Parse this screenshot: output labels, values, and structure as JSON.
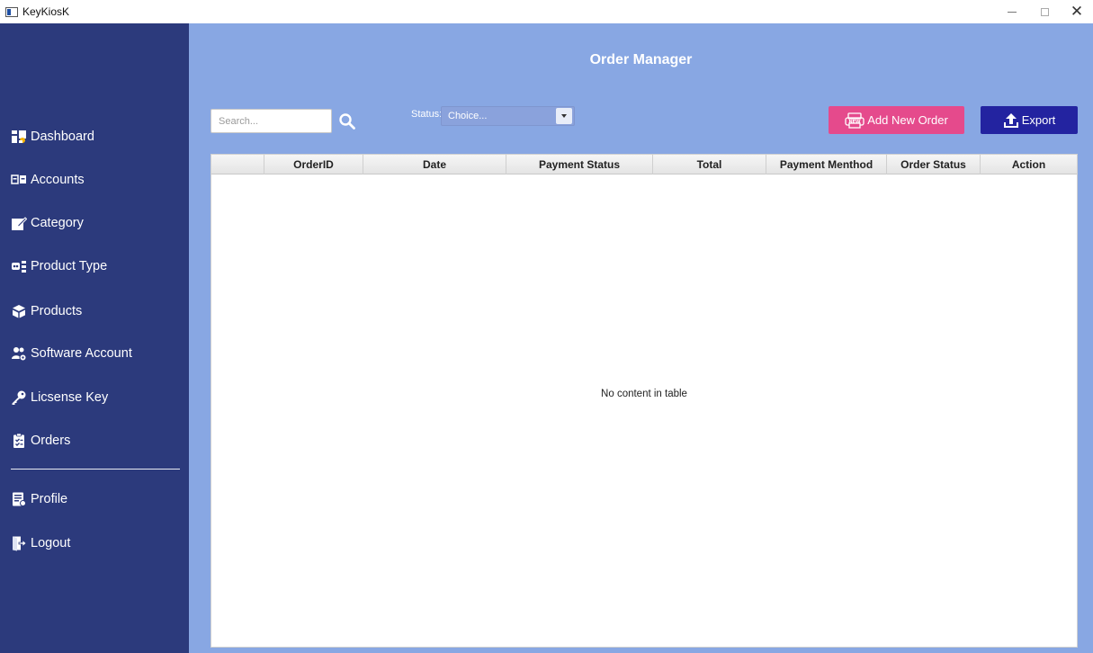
{
  "window": {
    "title": "KeyKiosK",
    "controls": {
      "minimize": "—",
      "maximize": "□",
      "close": "✕"
    }
  },
  "sidebar": {
    "items": [
      {
        "label": "Dashboard",
        "icon": "dashboard-icon"
      },
      {
        "label": "Accounts",
        "icon": "accounts-icon"
      },
      {
        "label": "Category",
        "icon": "category-icon"
      },
      {
        "label": "Product Type",
        "icon": "product-type-icon"
      },
      {
        "label": "Products",
        "icon": "products-icon"
      },
      {
        "label": "Software Account",
        "icon": "software-account-icon"
      },
      {
        "label": "Licsense Key",
        "icon": "key-icon"
      },
      {
        "label": "Orders",
        "icon": "orders-icon"
      }
    ],
    "bottom_items": [
      {
        "label": "Profile",
        "icon": "profile-icon"
      },
      {
        "label": "Logout",
        "icon": "logout-icon"
      }
    ]
  },
  "main": {
    "title": "Order Manager",
    "search": {
      "placeholder": "Search...",
      "value": ""
    },
    "status_filter": {
      "label": "Status:",
      "selected": "Choice..."
    },
    "add_button": {
      "label": "Add New Order",
      "icon": "new-order-icon"
    },
    "export_button": {
      "label": "Export",
      "icon": "upload-icon"
    },
    "table": {
      "columns": [
        "",
        "OrderID",
        "Date",
        "Payment Status",
        "Total",
        "Payment Menthod",
        "Order Status",
        "Action"
      ],
      "rows": [],
      "empty_text": "No content in table"
    }
  },
  "colors": {
    "sidebar_bg": "#2c3a7c",
    "main_bg": "#88a7e3",
    "add_button": "#e54a8c",
    "export_button": "#2323a0"
  }
}
